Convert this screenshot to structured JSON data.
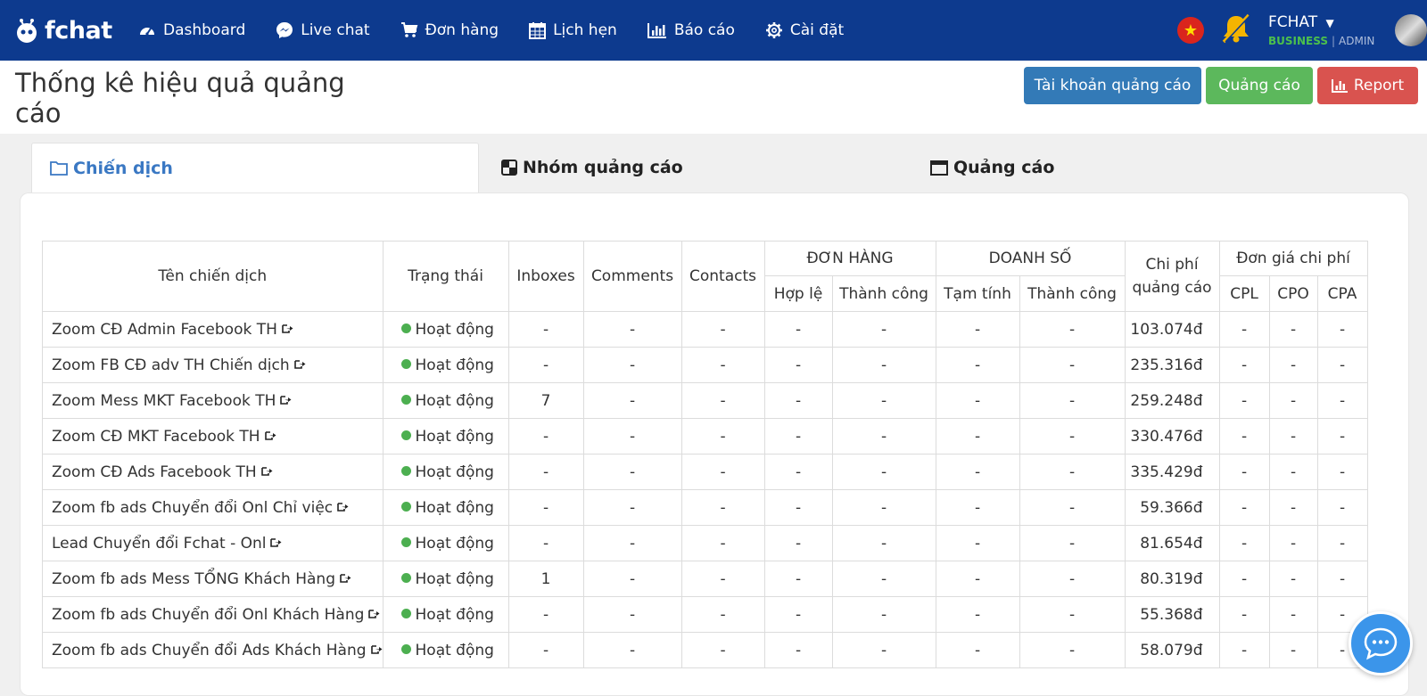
{
  "nav": {
    "logo": "fchat",
    "items": [
      {
        "label": "Dashboard",
        "icon": "dashboard-icon"
      },
      {
        "label": "Live chat",
        "icon": "messenger-icon"
      },
      {
        "label": "Đơn hàng",
        "icon": "cart-icon"
      },
      {
        "label": "Lịch hẹn",
        "icon": "calendar-icon"
      },
      {
        "label": "Báo cáo",
        "icon": "bar-chart-icon"
      },
      {
        "label": "Cài đặt",
        "icon": "gear-icon"
      }
    ],
    "account": {
      "name": "FCHAT",
      "plan": "BUSINESS",
      "role": "ADMIN"
    }
  },
  "header": {
    "title": "Thống kê hiệu quả quảng cáo",
    "buttons": {
      "ads_account": "Tài khoản quảng cáo",
      "ads": "Quảng cáo",
      "report": "Report"
    }
  },
  "tabs": [
    {
      "label": "Chiến dịch",
      "active": true
    },
    {
      "label": "Nhóm quảng cáo",
      "active": false
    },
    {
      "label": "Quảng cáo",
      "active": false
    }
  ],
  "table": {
    "headers": {
      "name": "Tên chiến dịch",
      "status": "Trạng thái",
      "inboxes": "Inboxes",
      "comments": "Comments",
      "contacts": "Contacts",
      "orders": "ĐƠN HÀNG",
      "orders_valid": "Hợp lệ",
      "orders_success": "Thành công",
      "revenue": "DOANH SỐ",
      "revenue_temp": "Tạm tính",
      "revenue_success": "Thành công",
      "cost_line1": "Chi phí",
      "cost_line2": "quảng cáo",
      "unit_cost": "Đơn giá chi phí",
      "cpl": "CPL",
      "cpo": "CPO",
      "cpa": "CPA"
    },
    "rows": [
      {
        "name": "Zoom CĐ Admin Facebook TH",
        "status": "Hoạt động",
        "inboxes": "-",
        "comments": "-",
        "contacts": "-",
        "valid": "-",
        "success": "-",
        "temp": "-",
        "rsuccess": "-",
        "cost": "103.074đ",
        "cpl": "-",
        "cpo": "-",
        "cpa": "-"
      },
      {
        "name": "Zoom FB CĐ adv TH Chiến dịch",
        "status": "Hoạt động",
        "inboxes": "-",
        "comments": "-",
        "contacts": "-",
        "valid": "-",
        "success": "-",
        "temp": "-",
        "rsuccess": "-",
        "cost": "235.316đ",
        "cpl": "-",
        "cpo": "-",
        "cpa": "-"
      },
      {
        "name": "Zoom Mess MKT Facebook TH",
        "status": "Hoạt động",
        "inboxes": "7",
        "comments": "-",
        "contacts": "-",
        "valid": "-",
        "success": "-",
        "temp": "-",
        "rsuccess": "-",
        "cost": "259.248đ",
        "cpl": "-",
        "cpo": "-",
        "cpa": "-"
      },
      {
        "name": "Zoom CĐ MKT Facebook TH",
        "status": "Hoạt động",
        "inboxes": "-",
        "comments": "-",
        "contacts": "-",
        "valid": "-",
        "success": "-",
        "temp": "-",
        "rsuccess": "-",
        "cost": "330.476đ",
        "cpl": "-",
        "cpo": "-",
        "cpa": "-"
      },
      {
        "name": "Zoom CĐ Ads Facebook TH",
        "status": "Hoạt động",
        "inboxes": "-",
        "comments": "-",
        "contacts": "-",
        "valid": "-",
        "success": "-",
        "temp": "-",
        "rsuccess": "-",
        "cost": "335.429đ",
        "cpl": "-",
        "cpo": "-",
        "cpa": "-"
      },
      {
        "name": "Zoom fb ads Chuyển đổi Onl Chỉ việc",
        "status": "Hoạt động",
        "inboxes": "-",
        "comments": "-",
        "contacts": "-",
        "valid": "-",
        "success": "-",
        "temp": "-",
        "rsuccess": "-",
        "cost": "59.366đ",
        "cpl": "-",
        "cpo": "-",
        "cpa": "-"
      },
      {
        "name": "Lead Chuyển đổi Fchat - Onl",
        "status": "Hoạt động",
        "inboxes": "-",
        "comments": "-",
        "contacts": "-",
        "valid": "-",
        "success": "-",
        "temp": "-",
        "rsuccess": "-",
        "cost": "81.654đ",
        "cpl": "-",
        "cpo": "-",
        "cpa": "-"
      },
      {
        "name": "Zoom fb ads Mess TỔNG Khách Hàng",
        "status": "Hoạt động",
        "inboxes": "1",
        "comments": "-",
        "contacts": "-",
        "valid": "-",
        "success": "-",
        "temp": "-",
        "rsuccess": "-",
        "cost": "80.319đ",
        "cpl": "-",
        "cpo": "-",
        "cpa": "-"
      },
      {
        "name": "Zoom fb ads Chuyển đổi Onl Khách Hàng",
        "status": "Hoạt động",
        "inboxes": "-",
        "comments": "-",
        "contacts": "-",
        "valid": "-",
        "success": "-",
        "temp": "-",
        "rsuccess": "-",
        "cost": "55.368đ",
        "cpl": "-",
        "cpo": "-",
        "cpa": "-"
      },
      {
        "name": "Zoom fb ads Chuyển đổi Ads Khách Hàng",
        "status": "Hoạt động",
        "inboxes": "-",
        "comments": "-",
        "contacts": "-",
        "valid": "-",
        "success": "-",
        "temp": "-",
        "rsuccess": "-",
        "cost": "58.079đ",
        "cpl": "-",
        "cpo": "-",
        "cpa": "-"
      }
    ]
  },
  "colors": {
    "nav_bg": "#0d3a8e",
    "primary": "#337ab7",
    "success": "#5cb85c",
    "danger": "#d9534f",
    "status_active": "#4caf50",
    "chat_bubble": "#3b95ea"
  }
}
